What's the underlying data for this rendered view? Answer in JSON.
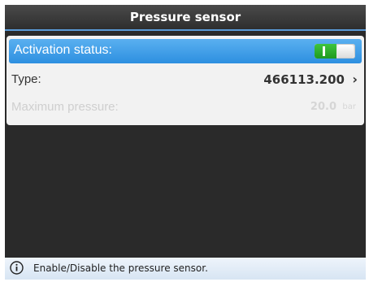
{
  "header": {
    "title": "Pressure sensor"
  },
  "settings": {
    "activation": {
      "label": "Activation status:",
      "state": "on"
    },
    "type": {
      "label": "Type:",
      "value": "466113.200",
      "chevron": "›"
    },
    "max_pressure": {
      "label": "Maximum pressure:",
      "value": "20.0",
      "unit": "bar"
    }
  },
  "status": {
    "info_icon": "info-icon",
    "message": "Enable/Disable the pressure sensor."
  },
  "colors": {
    "accent": "#2d8fe0",
    "toggle_on": "#2aa82a",
    "title_bg": "#333333"
  }
}
